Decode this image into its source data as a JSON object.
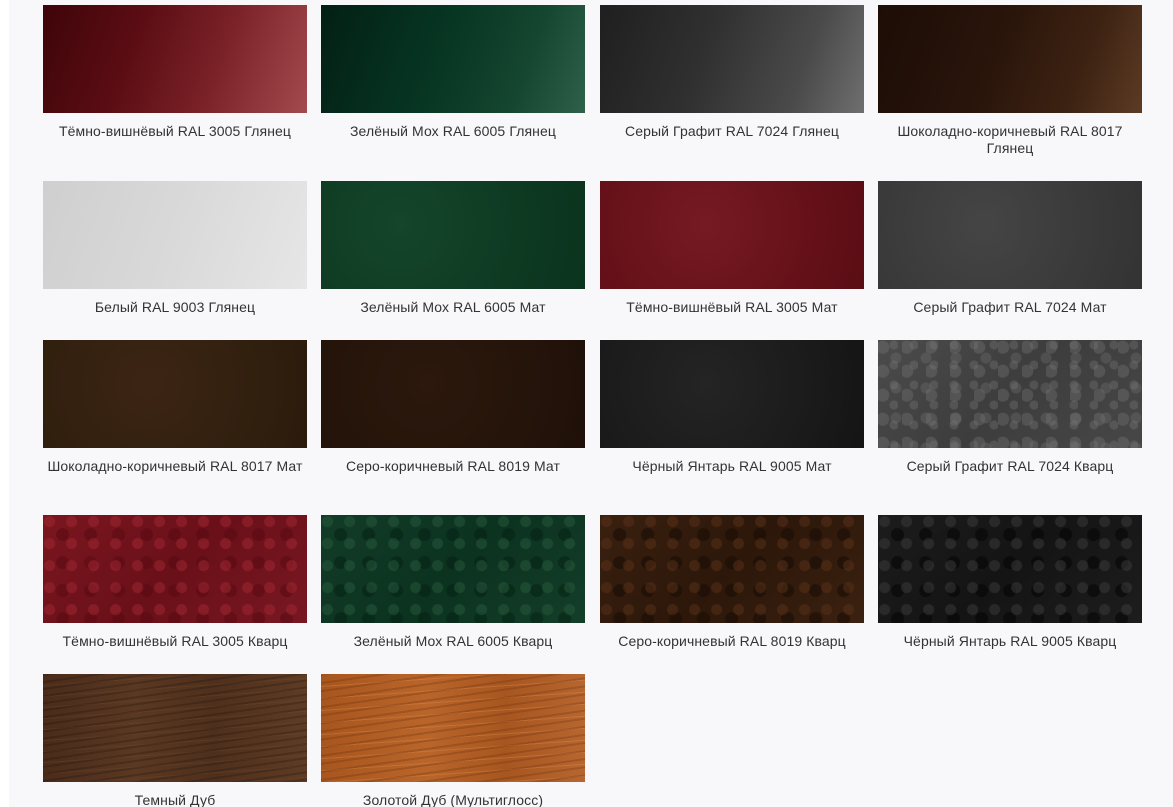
{
  "swatches": [
    {
      "label": "Тёмно-вишнёвый RAL 3005 Глянец",
      "color": "#6a141b"
    },
    {
      "label": "Зелёный Мох RAL 6005 Глянец",
      "color": "#0b3a25"
    },
    {
      "label": "Серый Графит RAL 7024 Глянец",
      "color": "#3a3a3a"
    },
    {
      "label": "Шоколадно-коричневый RAL 8017 Глянец",
      "color": "#2f180c"
    },
    {
      "label": "Белый RAL 9003 Глянец",
      "color": "#d8d8d8"
    },
    {
      "label": "Зелёный Мох RAL 6005 Мат",
      "color": "#0f3a23"
    },
    {
      "label": "Тёмно-вишнёвый RAL 3005 Мат",
      "color": "#68131b"
    },
    {
      "label": "Серый Графит RAL 7024 Мат",
      "color": "#3c3c3c"
    },
    {
      "label": "Шоколадно-коричневый RAL 8017 Мат",
      "color": "#33200f"
    },
    {
      "label": "Серо-коричневый RAL 8019 Мат",
      "color": "#25140a"
    },
    {
      "label": "Чёрный Янтарь RAL 9005 Мат",
      "color": "#1b1b1b"
    },
    {
      "label": "Серый Графит RAL 7024 Кварц",
      "color": "#444444"
    },
    {
      "label": "Тёмно-вишнёвый RAL 3005 Кварц",
      "color": "#701520"
    },
    {
      "label": "Зелёный Мох RAL 6005 Кварц",
      "color": "#0f3523"
    },
    {
      "label": "Серо-коричневый RAL 8019 Кварц",
      "color": "#341c0c"
    },
    {
      "label": "Чёрный Янтарь RAL 9005 Кварц",
      "color": "#171717"
    },
    {
      "label": "Темный Дуб",
      "color": "#523220"
    },
    {
      "label": "Золотой Дуб (Мультиглосс)",
      "color": "#b05d25"
    }
  ]
}
